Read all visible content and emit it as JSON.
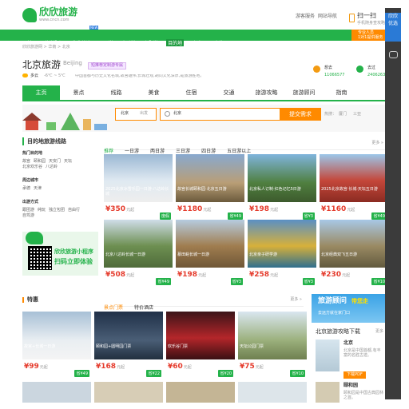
{
  "header": {
    "logo_text": "欣欣旅游",
    "domain_text": "www.cncn.com",
    "links": [
      "游客服务",
      "网站导航"
    ],
    "scan_title": "扫一扫",
    "scan_sub": "手机随身查攻略",
    "side_promo": [
      "欣欣",
      "优选"
    ]
  },
  "topnav": {
    "items": [
      "首页",
      "旅游顾问",
      "欣欣优选",
      "跟团游",
      "自助游",
      "主题游",
      "目的地",
      "攻略",
      "百宝箱"
    ],
    "new_badge": "NEW",
    "consult": [
      "专业人员",
      "1对1提供服务"
    ]
  },
  "breadcrumb": [
    "欣欣旅游网",
    "华南",
    "北京"
  ],
  "city": {
    "name": "北京旅游",
    "pinyin": "Beijing",
    "tag": "短推荐定制游专属",
    "weather": "多云",
    "temp": "-6℃ ~ 5℃",
    "desc": "中国首都与历史文化名城,故宫雄伟,长城壮观,胡同文化深厚,是旅游胜地。",
    "stats": [
      {
        "label": "想去",
        "value": "11066577"
      },
      {
        "label": "去过",
        "value": "2406263"
      }
    ]
  },
  "tabs": [
    "主页",
    "景点",
    "线路",
    "美食",
    "住宿",
    "交通",
    "旅游攻略",
    "旅游顾问",
    "指南"
  ],
  "search": {
    "from_label": "北京",
    "from_hint": "出发",
    "query": "北京",
    "button": "提交需求",
    "hot_label": "热搜：",
    "hot_items": [
      "厦门",
      "三亚"
    ]
  },
  "left": {
    "title": "目的地旅游线路",
    "sections": [
      {
        "title": "热门目的地",
        "items": [
          "故宫",
          "颐和园",
          "天安门",
          "天坛",
          "北京欢乐谷",
          "八达岭"
        ]
      },
      {
        "title": "周边城市",
        "items": [
          "承德",
          "天津"
        ]
      },
      {
        "title": "出游方式",
        "items": [
          "跟团游",
          "纯玩",
          "独立包团",
          "自由行",
          "自驾游"
        ]
      }
    ],
    "miniapp_title": "欣欣旅游小程序",
    "miniapp_sub": "扫码立即体验"
  },
  "filters": [
    "推荐",
    "一日游",
    "两日游",
    "三日游",
    "四日游",
    "五日游以上"
  ],
  "more": "更多 »",
  "tours": [
    {
      "caption": "2025北京冰雪乐园一日游·八达岭长城",
      "badge": "度假",
      "price": "350"
    },
    {
      "caption": "故宫长城颐和园·北京五日游",
      "badge": "省¥49",
      "price": "1180"
    },
    {
      "caption": "北京私人订制·红色记忆5日游",
      "badge": "省¥3",
      "price": "198"
    },
    {
      "caption": "2025北京故宫·长城·天坛五日游",
      "badge": "省¥49",
      "price": "1160"
    },
    {
      "caption": "北京八达岭长城一日游",
      "badge": "省¥49",
      "price": "508"
    },
    {
      "caption": "慕田峪长城一日游",
      "badge": "省¥3",
      "price": "198"
    },
    {
      "caption": "北京亲子研学游",
      "badge": "省¥3",
      "price": "258"
    },
    {
      "caption": "北京经典双飞五日游",
      "badge": "省¥10",
      "price": "230"
    }
  ],
  "specials": {
    "title": "特惠",
    "tabs": [
      "景点门票",
      "特价酒店"
    ],
    "items": [
      {
        "caption": "故宫+长城一日游",
        "badge": "省¥49",
        "price": "99"
      },
      {
        "caption": "颐和园+圆明园门票",
        "badge": "省¥22",
        "price": "168"
      },
      {
        "caption": "欢乐谷门票",
        "badge": "省¥20",
        "price": "60"
      },
      {
        "caption": "天坛公园门票",
        "badge": "省¥10",
        "price": "75"
      }
    ]
  },
  "guide": {
    "banner_top": "旅游顾问",
    "banner_mid": "带您走",
    "banner_sub": "去远方就在家门口",
    "list_title": "北京旅游攻略下载",
    "items": [
      {
        "title": "北京",
        "desc": "北京是中国首都,有丰富的名胜古迹。",
        "button": "下载PDF"
      },
      {
        "title": "颐和园",
        "desc": "颐和园是中国古典园林之首。"
      }
    ]
  },
  "unit": "元起",
  "currency": "¥",
  "colors": {
    "brand": "#24b24a",
    "price": "#e53b2c",
    "button": "#ff8a00",
    "sidebar": "#3b3b3b"
  }
}
